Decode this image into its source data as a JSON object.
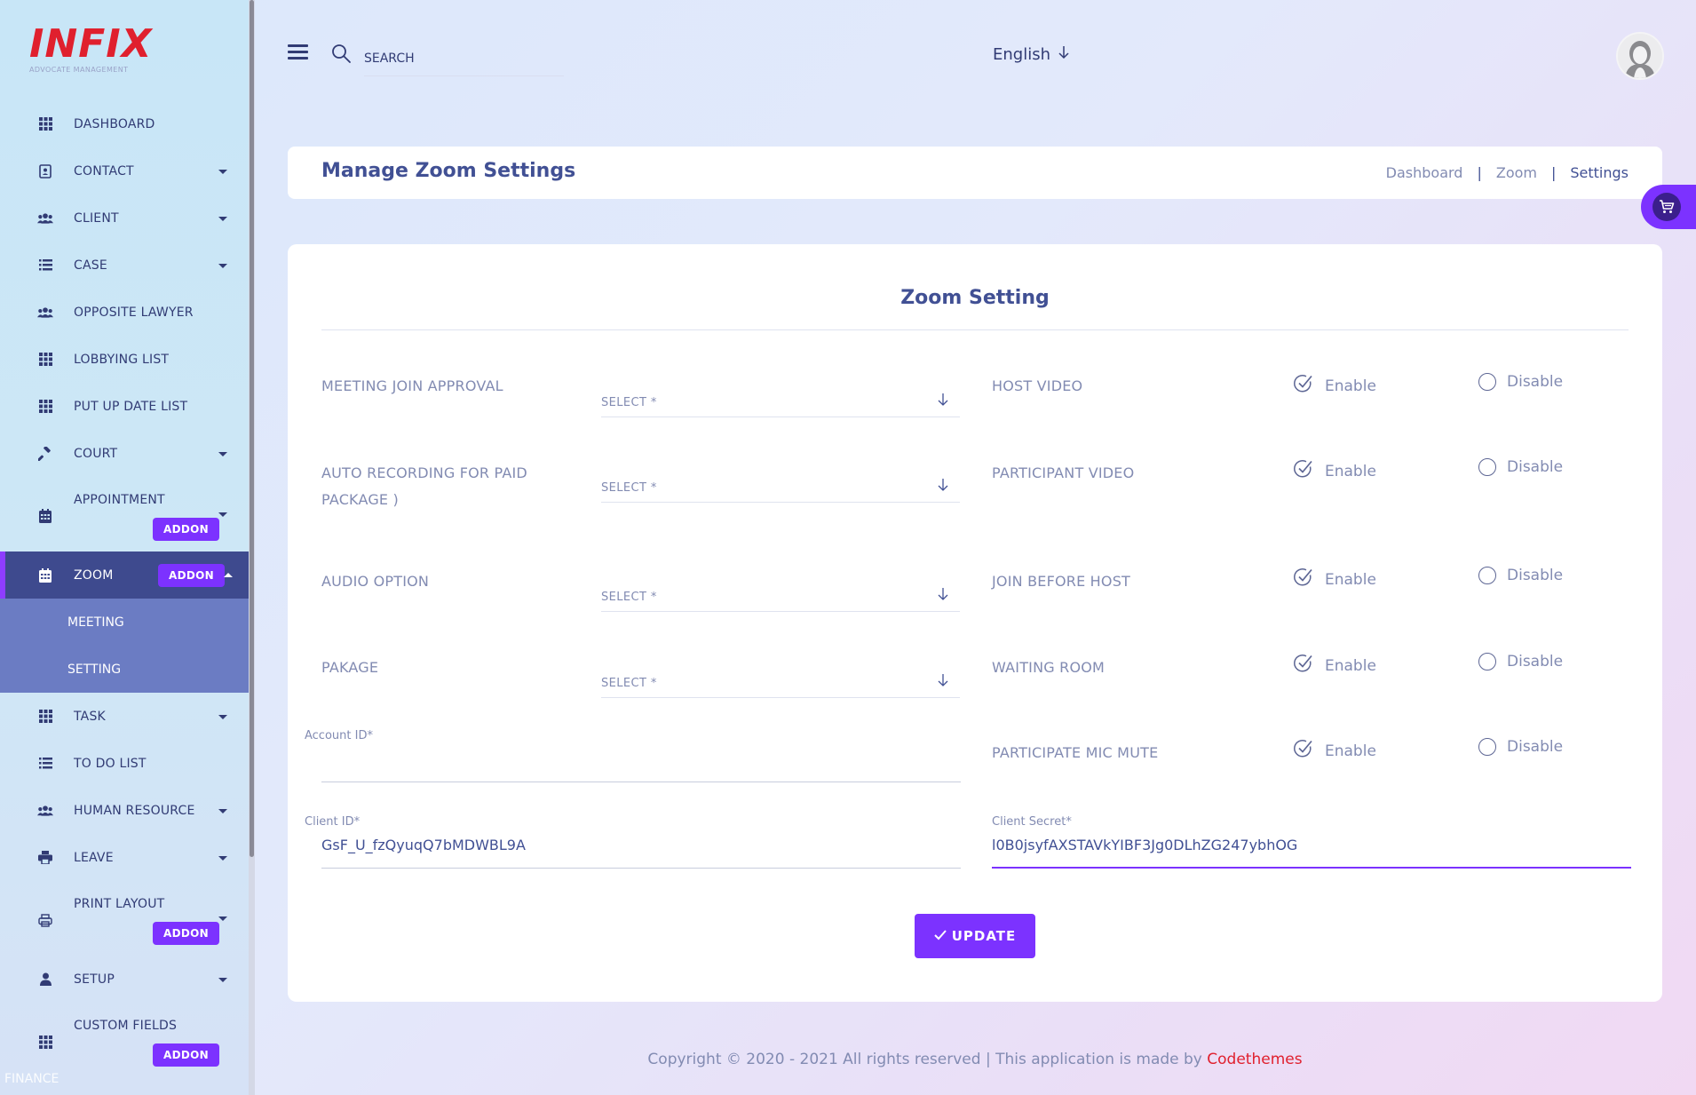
{
  "app": {
    "logo_text": "INFIX",
    "logo_sub": "ADVOCATE MANAGEMENT"
  },
  "sidebar": {
    "items": [
      {
        "label": "DASHBOARD",
        "icon": "grid-icon"
      },
      {
        "label": "CONTACT",
        "icon": "contact-book-icon"
      },
      {
        "label": "CLIENT",
        "icon": "users-icon"
      },
      {
        "label": "CASE",
        "icon": "list-icon"
      },
      {
        "label": "OPPOSITE LAWYER",
        "icon": "users-icon"
      },
      {
        "label": "LOBBYING LIST",
        "icon": "grid-icon"
      },
      {
        "label": "PUT UP DATE LIST",
        "icon": "grid-icon"
      },
      {
        "label": "COURT",
        "icon": "gavel-icon"
      },
      {
        "label": "APPOINTMENT",
        "icon": "calendar-icon",
        "addon": "ADDON"
      },
      {
        "label": "ZOOM",
        "icon": "calendar-icon",
        "addon": "ADDON"
      },
      {
        "label": "TASK",
        "icon": "grid-icon"
      },
      {
        "label": "TO DO LIST",
        "icon": "list-icon"
      },
      {
        "label": "HUMAN RESOURCE",
        "icon": "users-icon"
      },
      {
        "label": "LEAVE",
        "icon": "printer-icon"
      },
      {
        "label": "PRINT LAYOUT",
        "icon": "printer-icon",
        "addon": "ADDON"
      },
      {
        "label": "SETUP",
        "icon": "user-icon"
      },
      {
        "label": "CUSTOM FIELDS",
        "icon": "grid-icon",
        "addon": "ADDON"
      }
    ],
    "zoom_sub": [
      "MEETING",
      "SETTING"
    ],
    "finance": "FINANCE"
  },
  "topbar": {
    "search_placeholder": "SEARCH",
    "language": "English"
  },
  "header": {
    "title": "Manage Zoom Settings",
    "breadcrumb": [
      "Dashboard",
      "Zoom",
      "Settings"
    ],
    "sep": "|"
  },
  "card": {
    "title": "Zoom Setting",
    "left_selects": [
      {
        "label_lines": [
          "MEETING JOIN APPROVAL"
        ],
        "value": "SELECT *"
      },
      {
        "label_lines": [
          "AUTO RECORDING FOR PAID",
          "PACKAGE )"
        ],
        "value": "SELECT *"
      },
      {
        "label_lines": [
          "AUDIO OPTION"
        ],
        "value": "SELECT *"
      },
      {
        "label_lines": [
          "PAKAGE"
        ],
        "value": "SELECT *"
      }
    ],
    "right_toggles": [
      {
        "label": "HOST VIDEO",
        "enable": "Enable",
        "disable": "Disable",
        "selected": "enable"
      },
      {
        "label": "PARTICIPANT VIDEO",
        "enable": "Enable",
        "disable": "Disable",
        "selected": "enable"
      },
      {
        "label": "JOIN BEFORE HOST",
        "enable": "Enable",
        "disable": "Disable",
        "selected": "enable"
      },
      {
        "label": "WAITING ROOM",
        "enable": "Enable",
        "disable": "Disable",
        "selected": "enable"
      },
      {
        "label": "PARTICIPATE MIC MUTE",
        "enable": "Enable",
        "disable": "Disable",
        "selected": "enable"
      }
    ],
    "account_id": {
      "label": "Account ID*",
      "value": ""
    },
    "client_id": {
      "label": "Client ID*",
      "value": "GsF_U_fzQyuqQ7bMDWBL9A"
    },
    "client_secret": {
      "label": "Client Secret*",
      "value": "l0B0jsyfAXSTAVkYIBF3Jg0DLhZG247ybhOG"
    },
    "update_label": "UPDATE"
  },
  "footer": {
    "text": "Copyright © 2020 - 2021 All rights reserved | This application is made by ",
    "brand": "Codethemes"
  },
  "colors": {
    "accent": "#7c32ff",
    "navy": "#415094",
    "brand_red": "#e0202e"
  }
}
